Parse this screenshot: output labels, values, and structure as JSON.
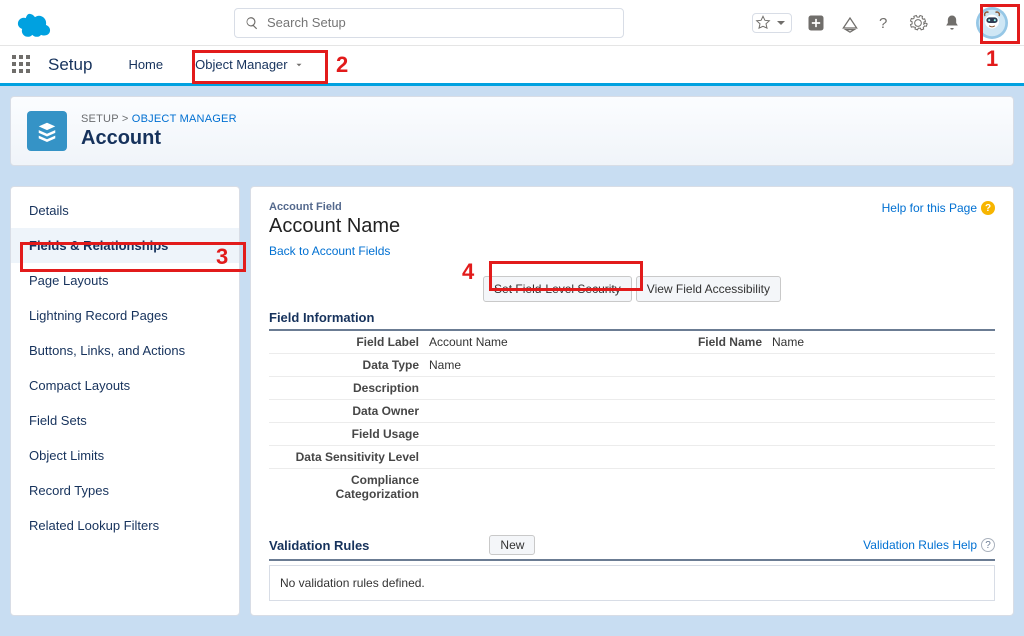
{
  "header": {
    "search_placeholder": "Search Setup"
  },
  "context": {
    "setup_label": "Setup",
    "home_label": "Home",
    "object_manager_label": "Object Manager"
  },
  "breadcrumb": {
    "setup": "SETUP",
    "sep": ">",
    "om": "OBJECT MANAGER",
    "object_title": "Account"
  },
  "sidebar": {
    "items": [
      {
        "label": "Details"
      },
      {
        "label": "Fields & Relationships"
      },
      {
        "label": "Page Layouts"
      },
      {
        "label": "Lightning Record Pages"
      },
      {
        "label": "Buttons, Links, and Actions"
      },
      {
        "label": "Compact Layouts"
      },
      {
        "label": "Field Sets"
      },
      {
        "label": "Object Limits"
      },
      {
        "label": "Record Types"
      },
      {
        "label": "Related Lookup Filters"
      }
    ],
    "active_index": 1
  },
  "content": {
    "crumb": "Account Field",
    "title": "Account Name",
    "back_link": "Back to Account Fields",
    "help_link": "Help for this Page",
    "buttons": {
      "set_fls": "Set Field-Level Security",
      "view_access": "View Field Accessibility"
    },
    "field_info_header": "Field Information",
    "fields": {
      "field_label_l": "Field Label",
      "field_label_v": "Account Name",
      "field_name_l": "Field Name",
      "field_name_v": "Name",
      "data_type_l": "Data Type",
      "data_type_v": "Name",
      "description_l": "Description",
      "data_owner_l": "Data Owner",
      "field_usage_l": "Field Usage",
      "sensitivity_l": "Data Sensitivity Level",
      "compliance_l": "Compliance Categorization"
    },
    "validation": {
      "header": "Validation Rules",
      "new_btn": "New",
      "help": "Validation Rules Help",
      "empty_msg": "No validation rules defined."
    }
  },
  "annotations": {
    "n1": "1",
    "n2": "2",
    "n3": "3",
    "n4": "4"
  }
}
